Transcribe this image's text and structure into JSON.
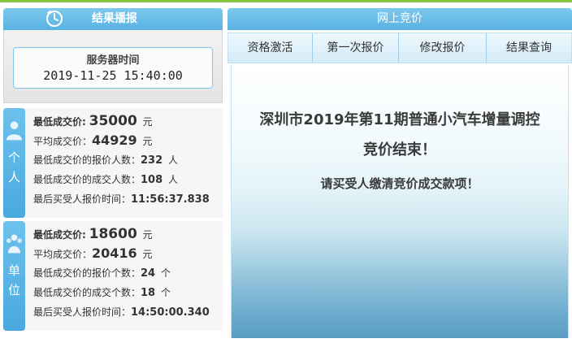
{
  "left": {
    "header_title": "结果播报",
    "server_label": "服务器时间",
    "server_time": "2019-11-25 15:40:00"
  },
  "personal": {
    "tab_chars": [
      "个",
      "人"
    ],
    "min_price_label": "最低成交价:",
    "min_price_value": "35000",
    "avg_price_label": "平均成交价：",
    "avg_price_value": "44929",
    "min_bidders_label": "最低成交价的报价人数：",
    "min_bidders_value": "232",
    "min_deal_label": "最低成交价的成交人数：",
    "min_deal_value": "108",
    "last_time_label": "最后买受人报价时间：",
    "last_time_value": "11:56:37.838",
    "unit_yuan": "元",
    "unit_person": "人"
  },
  "unit": {
    "tab_chars": [
      "单",
      "位"
    ],
    "min_price_label": "最低成交价:",
    "min_price_value": "18600",
    "avg_price_label": "平均成交价：",
    "avg_price_value": "20416",
    "min_bidders_label": "最低成交价的报价个数：",
    "min_bidders_value": "24",
    "min_deal_label": "最低成交价的成交个数：",
    "min_deal_value": "18",
    "last_time_label": "最后买受人报价时间：",
    "last_time_value": "14:50:00.340",
    "unit_yuan": "元",
    "unit_count": "个"
  },
  "right": {
    "header_title": "网上竞价",
    "tabs": [
      "资格激活",
      "第一次报价",
      "修改报价",
      "结果查询"
    ],
    "message_line1": "深圳市2019年第11期普通小汽车增量调控",
    "message_line2": "竞价结束！",
    "message_line3": "请买受人缴清竞价成交款项！"
  },
  "colors": {
    "header_blue": "#5ab3e2",
    "tab_blue": "#4aa9df",
    "accent_green": "#8cc63e"
  },
  "icons": {
    "clock": "clock-icon",
    "person": "person-icon",
    "group": "group-icon"
  }
}
